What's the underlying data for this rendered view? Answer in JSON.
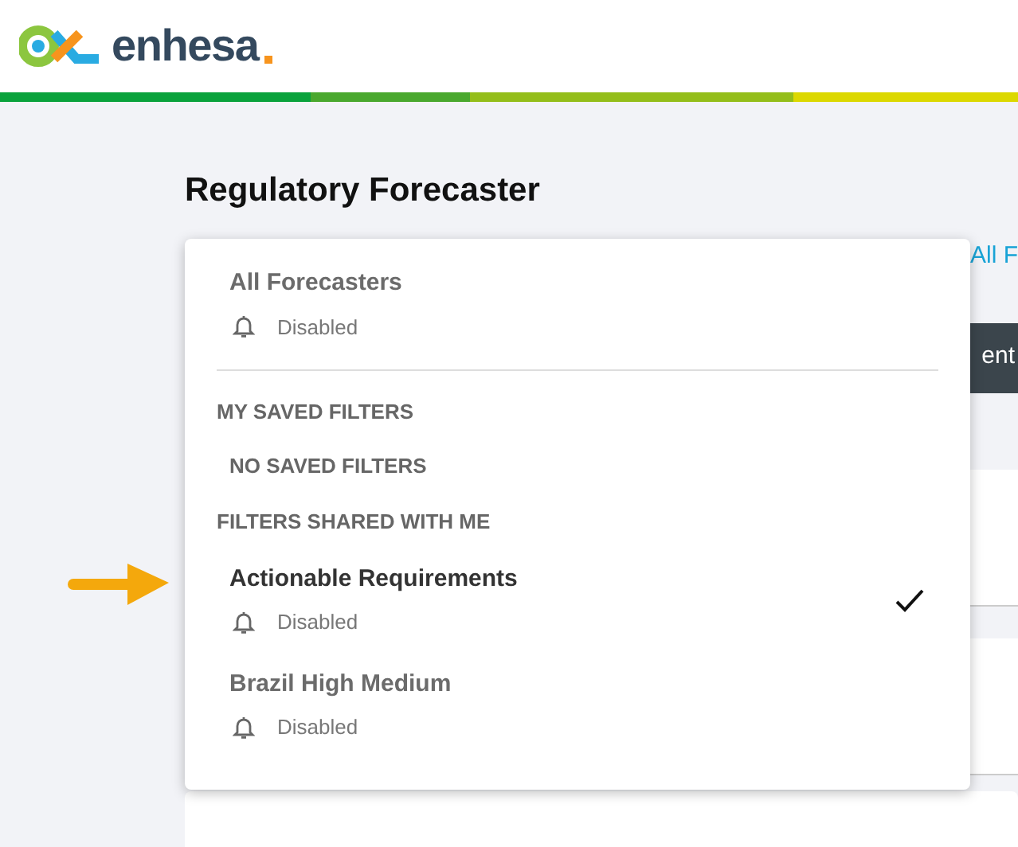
{
  "logo": {
    "wordmark": "enhesa"
  },
  "page_title": "Regulatory Forecaster",
  "background": {
    "link": "All F",
    "button": "ent"
  },
  "dropdown": {
    "top_item": {
      "name": "All Forecasters",
      "status": "Disabled",
      "selected": false
    },
    "sections": [
      {
        "heading": "MY SAVED FILTERS",
        "empty_text": "NO SAVED FILTERS"
      },
      {
        "heading": "FILTERS SHARED WITH ME",
        "items": [
          {
            "name": "Actionable Requirements",
            "status": "Disabled",
            "selected": true
          },
          {
            "name": "Brazil High Medium",
            "status": "Disabled",
            "selected": false
          }
        ]
      }
    ]
  }
}
